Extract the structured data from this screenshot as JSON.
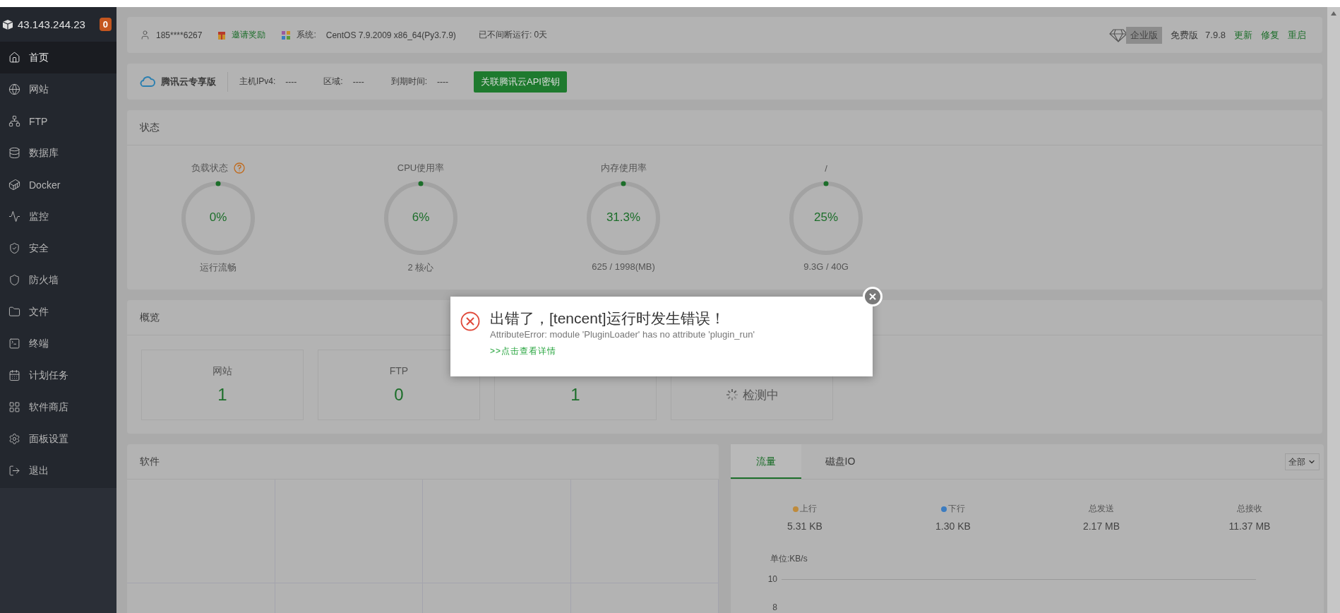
{
  "sidebar": {
    "host": "43.143.244.23",
    "badge": "0",
    "items": [
      {
        "kind": "home",
        "label": "首页",
        "selected": true
      },
      {
        "kind": "globe",
        "label": "网站",
        "selected": false
      },
      {
        "kind": "ftp",
        "label": "FTP",
        "selected": false
      },
      {
        "kind": "database",
        "label": "数据库",
        "selected": false
      },
      {
        "kind": "docker",
        "label": "Docker",
        "selected": false
      },
      {
        "kind": "monitor",
        "label": "监控",
        "selected": false
      },
      {
        "kind": "shield",
        "label": "安全",
        "selected": false
      },
      {
        "kind": "firewall",
        "label": "防火墙",
        "selected": false
      },
      {
        "kind": "folder",
        "label": "文件",
        "selected": false
      },
      {
        "kind": "terminal",
        "label": "终端",
        "selected": false
      },
      {
        "kind": "calendar",
        "label": "计划任务",
        "selected": false
      },
      {
        "kind": "grid",
        "label": "软件商店",
        "selected": false
      },
      {
        "kind": "gear",
        "label": "面板设置",
        "selected": false
      },
      {
        "kind": "logout",
        "label": "退出",
        "selected": false
      }
    ]
  },
  "info_bar": {
    "user": "185****6267",
    "invite": "邀请奖励",
    "system_label": "系统:",
    "system": "CentOS 7.9.2009 x86_64(Py3.7.9)",
    "uptime": "已不间断运行: 0天",
    "edition_badge": "企业版",
    "edition": "免费版",
    "version": "7.9.8",
    "actions": [
      "更新",
      "修复",
      "重启"
    ]
  },
  "cloud_bar": {
    "title": "腾讯云专享版",
    "fields": [
      {
        "label": "主机IPv4:",
        "value": "----"
      },
      {
        "label": "区域:",
        "value": "----"
      },
      {
        "label": "到期时间:",
        "value": "----"
      }
    ],
    "button": "关联腾讯云API密钥"
  },
  "status": {
    "title": "状态",
    "gauges": [
      {
        "label": "负载状态",
        "help": true,
        "value": "0%",
        "caption": "运行流畅"
      },
      {
        "label": "CPU使用率",
        "help": false,
        "value": "6%",
        "caption": "2 核心"
      },
      {
        "label": "内存使用率",
        "help": false,
        "value": "31.3%",
        "caption": "625 / 1998(MB)"
      },
      {
        "label": "/",
        "help": false,
        "value": "25%",
        "caption": "9.3G / 40G"
      }
    ]
  },
  "overview": {
    "title": "概览",
    "cards": [
      {
        "label": "网站",
        "value": "1",
        "loading": false
      },
      {
        "label": "FTP",
        "value": "0",
        "loading": false
      },
      {
        "value": "1",
        "loading": false
      },
      {
        "value": "检测中",
        "loading": true
      }
    ]
  },
  "software": {
    "title": "软件"
  },
  "traffic": {
    "tabs": [
      {
        "label": "流量",
        "selected": true
      },
      {
        "label": "磁盘IO",
        "selected": false
      }
    ],
    "filter": "全部",
    "stats": [
      {
        "label": "上行",
        "color": "#bf8b3c",
        "value": "5.31 KB"
      },
      {
        "label": "下行",
        "color": "#3c7cc0",
        "value": "1.30 KB"
      },
      {
        "label": "总发送",
        "value": "2.17 MB"
      },
      {
        "label": "总接收",
        "value": "11.37 MB"
      }
    ],
    "unit": "单位:KB/s",
    "yticks": [
      "10",
      "8"
    ]
  },
  "dialog": {
    "title": "出错了，[tencent]运行时发生错误！",
    "message": "AttributeError: module 'PluginLoader' has no attribute 'plugin_run'",
    "link": ">>点击查看详情"
  }
}
